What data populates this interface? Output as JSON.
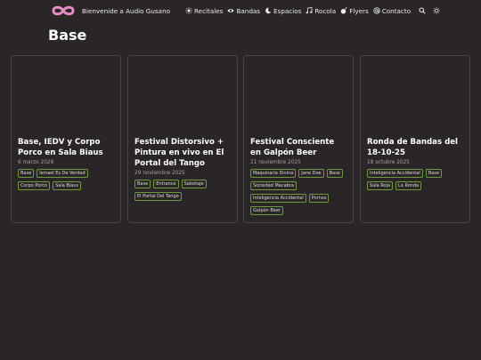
{
  "header": {
    "brand_text": "Bienvenide a Audio Gusano",
    "nav": [
      {
        "label": "Recitales",
        "icon": "sun-icon"
      },
      {
        "label": "Bandas",
        "icon": "eye-icon"
      },
      {
        "label": "Espacios",
        "icon": "moon-icon"
      },
      {
        "label": "Rocola",
        "icon": "music-note-icon"
      },
      {
        "label": "Flyers",
        "icon": "bomb-icon"
      },
      {
        "label": "Contacto",
        "icon": "at-icon"
      }
    ],
    "search_icon": "search-icon",
    "theme_icon": "sun-toggle-icon"
  },
  "page": {
    "title": "Base"
  },
  "cards": [
    {
      "title": "Base, IEDV y Corpo Porco en Sala Biaus",
      "date": "6 marzo 2026",
      "tags": [
        "Base",
        "Ismael Es De Verdad",
        "Corpo Porco",
        "Sala Biaus"
      ]
    },
    {
      "title": "Festival Distorsivo + Pintura en vivo en El Portal del Tango",
      "date": "29 noviembre 2025",
      "tags": [
        "Base",
        "Entrance",
        "Sabotaje",
        "El Portal Del Tango"
      ]
    },
    {
      "title": "Festival Consciente en Galpón Beer",
      "date": "21 noviembre 2025",
      "tags": [
        "Maquinaria Divina",
        "Jane Doe",
        "Base",
        "Sociedad Macabra",
        "Inteligencia Accidental",
        "Pornos",
        "Galpón Beer"
      ]
    },
    {
      "title": "Ronda de Bandas del 18-10-25",
      "date": "18 octubre 2025",
      "tags": [
        "Inteligencia Accidental",
        "Base",
        "Sala Roja",
        "La Ronda"
      ]
    }
  ],
  "colors": {
    "background": "#2a2526",
    "card_border": "#4a4445",
    "tag_border": "#6b9a3c",
    "logo": "#e58cc0"
  }
}
